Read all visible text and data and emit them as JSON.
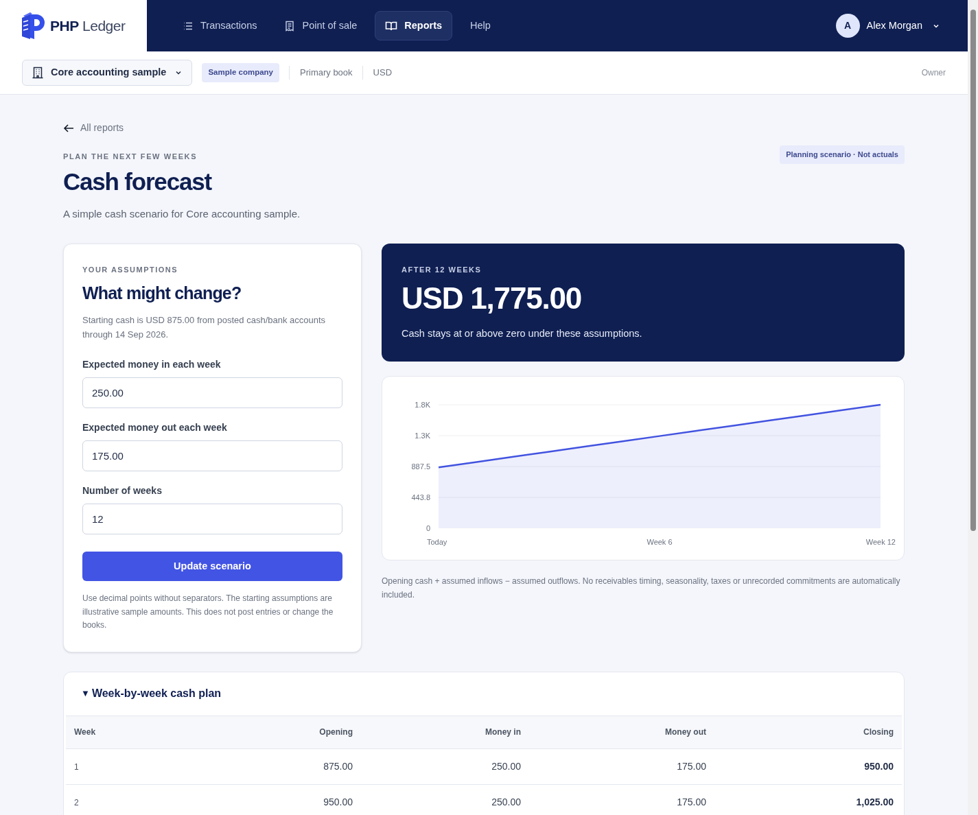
{
  "brand": {
    "name_bold": "PHP",
    "name_light": "Ledger"
  },
  "nav": [
    {
      "label": "Transactions",
      "selected": false
    },
    {
      "label": "Point of sale",
      "selected": false
    },
    {
      "label": "Reports",
      "selected": true
    },
    {
      "label": "Help",
      "selected": false
    }
  ],
  "user": {
    "initial": "A",
    "name": "Alex Morgan"
  },
  "context_bar": {
    "company": "Core accounting sample",
    "badge": "Sample company",
    "book": "Primary book",
    "currency": "USD",
    "role": "Owner"
  },
  "back_link": "All reports",
  "eyebrow": "PLAN THE NEXT FEW WEEKS",
  "title": "Cash forecast",
  "subtitle": "A simple cash scenario for Core accounting sample.",
  "scenario_badge": "Planning scenario · Not actuals",
  "assumptions": {
    "eyebrow": "YOUR ASSUMPTIONS",
    "heading": "What might change?",
    "intro": "Starting cash is USD 875.00 from posted cash/bank accounts through 14 Sep 2026.",
    "fields": [
      {
        "label": "Expected money in each week",
        "value": "250.00"
      },
      {
        "label": "Expected money out each week",
        "value": "175.00"
      },
      {
        "label": "Number of weeks",
        "value": "12"
      }
    ],
    "button": "Update scenario",
    "note": "Use decimal points without separators. The starting assumptions are illustrative sample amounts. This does not post entries or change the books."
  },
  "result": {
    "eyebrow": "AFTER 12 WEEKS",
    "amount": "USD 1,775.00",
    "message": "Cash stays at or above zero under these assumptions."
  },
  "chart_data": {
    "type": "area",
    "categories": [
      "Today",
      null,
      null,
      null,
      null,
      null,
      "Week 6",
      null,
      null,
      null,
      null,
      null,
      "Week 12"
    ],
    "grid": true,
    "series": [
      {
        "color": "#4253e0",
        "values": [
          875,
          950,
          1025,
          1100,
          1175,
          1250,
          1325,
          1400,
          1475,
          1550,
          1625,
          1700,
          1775
        ]
      }
    ],
    "ylim": [
      0,
      1775
    ],
    "yticks": [
      0,
      {
        "value": 443.75,
        "label": "443.8"
      },
      {
        "value": 887.5,
        "label": "887.5"
      },
      {
        "value": 1331.25,
        "label": "1.3K"
      },
      {
        "value": 1775,
        "label": "1.8K"
      }
    ]
  },
  "chart_note": "Opening cash + assumed inflows − assumed outflows. No receivables timing, seasonality, taxes or unrecorded commitments are automatically included.",
  "plan": {
    "summary": "Week-by-week cash plan",
    "marker": "▼",
    "expanded": true,
    "columns": [
      "Week",
      "Opening",
      "Money in",
      "Money out",
      "Closing"
    ],
    "rows": [
      [
        "1",
        "875.00",
        "250.00",
        "175.00",
        "950.00"
      ],
      [
        "2",
        "950.00",
        "250.00",
        "175.00",
        "1,025.00"
      ]
    ]
  }
}
